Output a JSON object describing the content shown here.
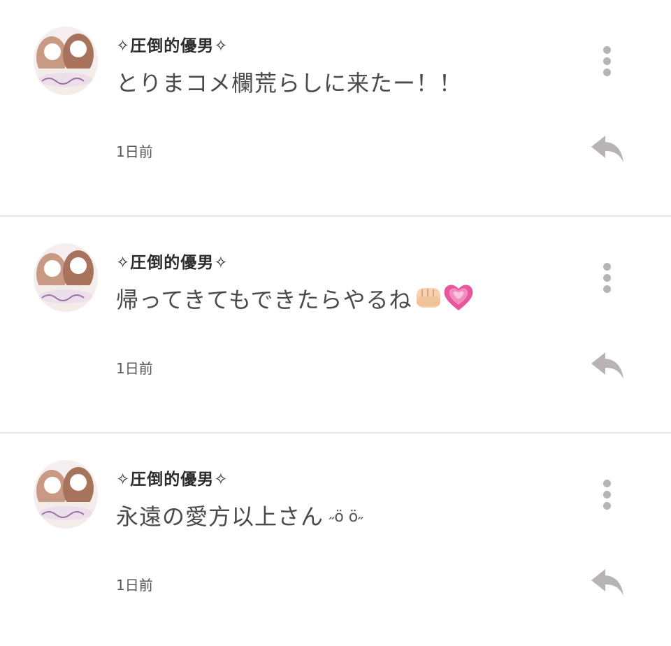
{
  "comments": [
    {
      "username": "✧圧倒的優男✧",
      "text": "とりまコメ欄荒らしに来たー！！",
      "timestamp": "1日前"
    },
    {
      "username": "✧圧倒的優男✧",
      "text": "帰ってきてもできたらやるね",
      "emoji": [
        "oncoming-fist",
        "growing-heart"
      ],
      "timestamp": "1日前"
    },
    {
      "username": "✧圧倒的優男✧",
      "text": "永遠の愛方以上さん",
      "kaomoji": "˶ӧ ӧ˶",
      "timestamp": "1日前"
    }
  ],
  "icons": {
    "more": "vertical-ellipsis-icon",
    "reply": "reply-arrow-icon",
    "avatar": "user-avatar"
  },
  "colors": {
    "divider": "#e6e6e6",
    "icon": "#b8b3b5",
    "heart": "#e8579b",
    "text": "#4a4a4a"
  }
}
